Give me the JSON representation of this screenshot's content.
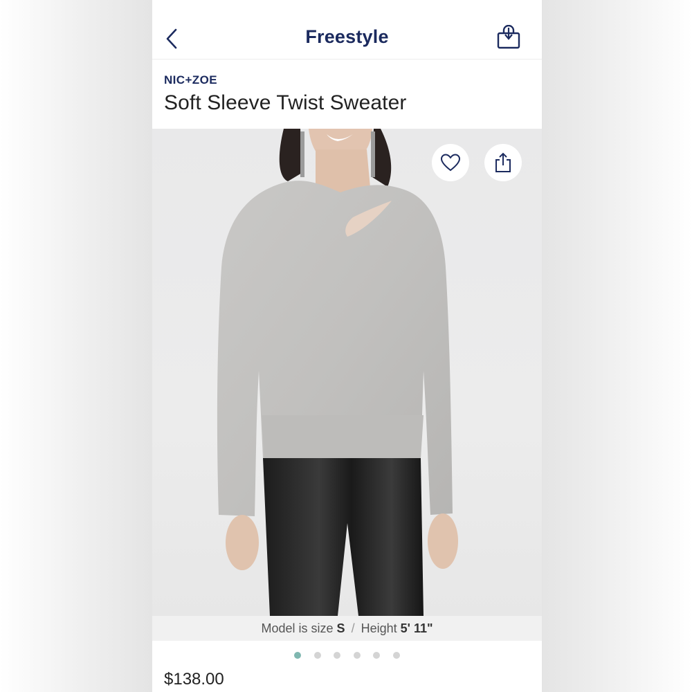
{
  "header": {
    "title": "Freestyle",
    "back_icon": "chevron-left-icon",
    "bag_icon": "shopping-bag-icon"
  },
  "product": {
    "brand": "NIC+ZOE",
    "title": "Soft Sleeve Twist Sweater",
    "price": "$138.00"
  },
  "hero": {
    "favorite_icon": "heart-icon",
    "share_icon": "share-icon",
    "caption": {
      "prefix": "Model is size",
      "size": "S",
      "separator": "/",
      "height_label": "Height",
      "height_value": "5' 11\""
    }
  },
  "carousel": {
    "total": 6,
    "active_index": 0
  },
  "colors": {
    "brand_navy": "#1b2a5e",
    "active_dot": "#7fb7b0",
    "inactive_dot": "#d4d4d4"
  }
}
